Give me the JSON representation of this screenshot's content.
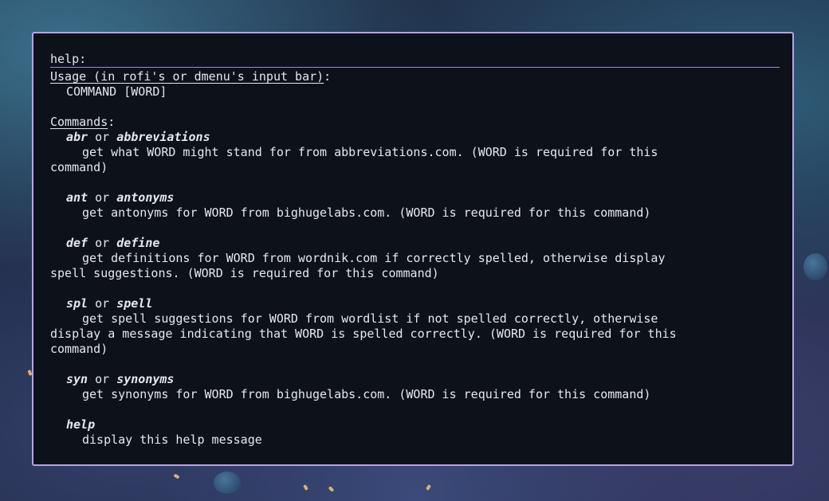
{
  "prompt": {
    "label": "help:"
  },
  "usage": {
    "heading": "Usage (in rofi's or dmenu's input bar)",
    "colon": ":",
    "syntax": "COMMAND [WORD]"
  },
  "commands_heading": "Commands",
  "commands_colon": ":",
  "commands": [
    {
      "name": "abr",
      "or": " or ",
      "alias": "abbreviations",
      "desc_lines": [
        "get what WORD might stand for from abbreviations.com. (WORD is required for this",
        "command)"
      ]
    },
    {
      "name": "ant",
      "or": " or ",
      "alias": "antonyms",
      "desc_lines": [
        "get antonyms for WORD from bighugelabs.com. (WORD is required for this command)"
      ]
    },
    {
      "name": "def",
      "or": " or ",
      "alias": "define",
      "desc_lines": [
        "get definitions for WORD from wordnik.com if correctly spelled, otherwise display",
        "spell suggestions. (WORD is required for this command)"
      ]
    },
    {
      "name": "spl",
      "or": " or ",
      "alias": "spell",
      "desc_lines": [
        "get spell suggestions for WORD from wordlist if not spelled correctly, otherwise",
        "display a message indicating that WORD is spelled correctly. (WORD is required for this",
        "command)"
      ]
    },
    {
      "name": "syn",
      "or": " or ",
      "alias": "synonyms",
      "desc_lines": [
        "get synonyms for WORD from bighugelabs.com. (WORD is required for this command)"
      ]
    },
    {
      "name": "help",
      "or": "",
      "alias": "",
      "desc_lines": [
        "display this help message"
      ]
    }
  ],
  "colors": {
    "window_bg": "#0d111a",
    "border": "#b7a2e3",
    "text": "#e6e8ef"
  }
}
